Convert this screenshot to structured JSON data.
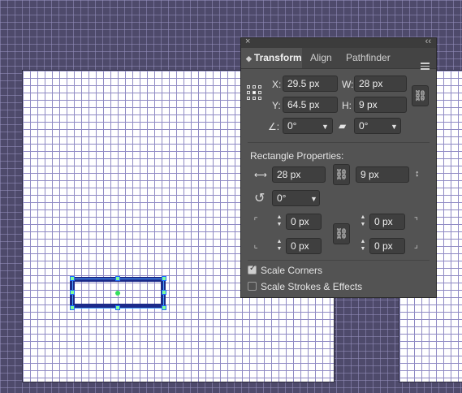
{
  "panel": {
    "tabs": [
      {
        "label": "Transform"
      },
      {
        "label": "Align"
      },
      {
        "label": "Pathfinder"
      }
    ],
    "transform": {
      "x_label": "X:",
      "x_value": "29.5 px",
      "y_label": "Y:",
      "y_value": "64.5 px",
      "w_label": "W:",
      "w_value": "28 px",
      "h_label": "H:",
      "h_value": "9 px",
      "angle_label": "∠:",
      "angle_value": "0°",
      "shear_value": "0°"
    },
    "rectangle": {
      "section_title": "Rectangle Properties:",
      "width_value": "28 px",
      "height_value": "9 px",
      "rotation_value": "0°",
      "corner_tl": "0 px",
      "corner_tr": "0 px",
      "corner_bl": "0 px",
      "corner_br": "0 px"
    },
    "options": {
      "scale_corners": {
        "label": "Scale Corners",
        "checked": true
      },
      "scale_strokes": {
        "label": "Scale Strokes & Effects",
        "checked": false
      }
    }
  },
  "colors": {
    "canvas": "#4e4a6b",
    "shape_stroke": "#1b2a8a",
    "handle": "#7dff9a",
    "panel_bg": "#535353"
  }
}
